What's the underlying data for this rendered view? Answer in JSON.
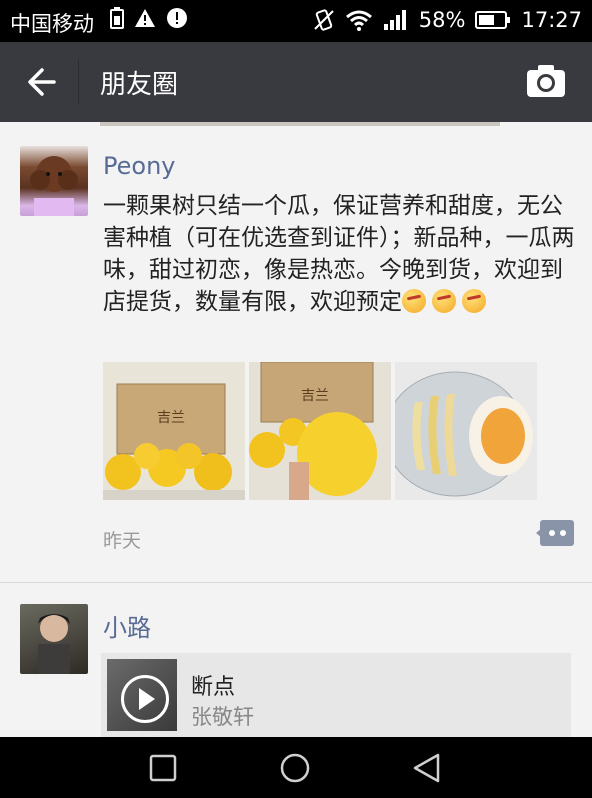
{
  "status_bar": {
    "carrier": "中国移动",
    "battery_percent": "58%",
    "time": "17:27",
    "icons": [
      "sim-icon",
      "warning-icon",
      "alert-icon",
      "vibrate-icon",
      "wifi-icon",
      "signal-icon",
      "battery-icon"
    ]
  },
  "app_bar": {
    "title": "朋友圈",
    "back_icon": "arrow-left-icon",
    "camera_icon": "camera-icon"
  },
  "posts": [
    {
      "author": "Peony",
      "text": "一颗果树只结一个瓜，保证营养和甜度，无公害种植（可在优选查到证件）；新品种，一瓜两味，甜过初恋，像是热恋。今晚到货，欢迎到店提货，数量有限，欢迎预定",
      "emoji_count": 3,
      "photo_count": 3,
      "photos": [
        {
          "box_label": "吉兰"
        },
        {
          "box_label": "吉兰"
        },
        {
          "box_label": ""
        }
      ],
      "time": "昨天"
    },
    {
      "author": "小路",
      "music": {
        "title": "断点",
        "artist": "张敬轩"
      }
    }
  ],
  "nav_bar": {
    "icons": [
      "recent-apps-icon",
      "home-icon",
      "back-triangle-icon"
    ]
  },
  "colors": {
    "app_bar": "#393a3f",
    "author_name": "#576b95",
    "background": "#f3f3f3"
  }
}
